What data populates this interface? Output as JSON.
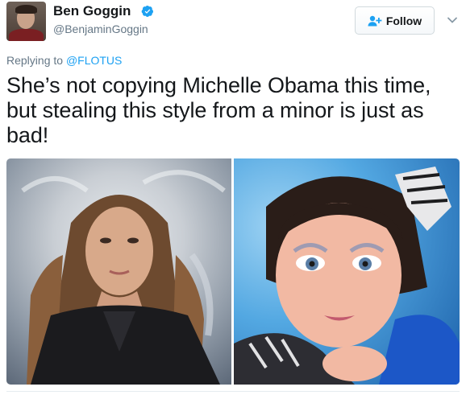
{
  "author": {
    "name": "Ben Goggin",
    "handle": "@BenjaminGoggin",
    "verified": true
  },
  "actions": {
    "follow_label": "Follow"
  },
  "reply": {
    "prefix": "Replying to",
    "to": "@FLOTUS"
  },
  "tweet": {
    "text": "She’s not copying Michelle Obama this time, but stealing this style from a minor is just as bad!"
  },
  "colors": {
    "link": "#1da1f2",
    "verified": "#1da1f2",
    "muted_text": "#657786",
    "primary_text": "#14171a",
    "border": "#e6ecf0"
  },
  "icons": {
    "verified": "verified-badge-icon",
    "follow": "add-person-icon",
    "caret": "chevron-down-icon"
  }
}
